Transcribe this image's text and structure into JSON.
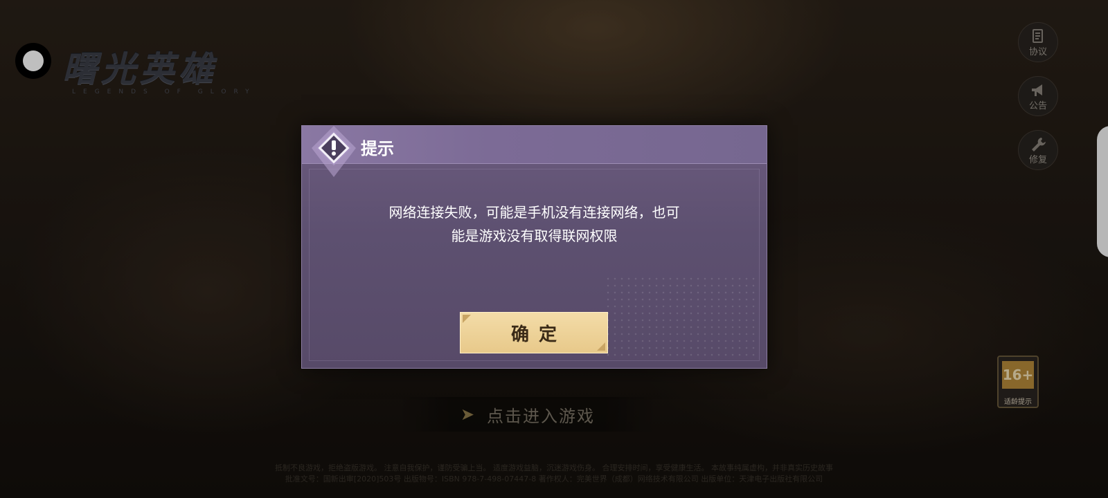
{
  "logo": {
    "title_cn": "曙光英雄",
    "title_en": "LEGENDS OF GLORY"
  },
  "side_menu": [
    {
      "label": "协议",
      "icon": "document-icon"
    },
    {
      "label": "公告",
      "icon": "megaphone-icon"
    },
    {
      "label": "修复",
      "icon": "wrench-icon"
    }
  ],
  "age_rating": {
    "age": "16+",
    "label": "适龄提示"
  },
  "enter_game": {
    "label": "点击进入游戏"
  },
  "legal": {
    "line1": "抵制不良游戏，拒绝盗版游戏。 注意自我保护，谨防受骗上当。 适度游戏益脑，沉迷游戏伤身。 合理安排时间，享受健康生活。 本故事纯属虚构，并非真实历史故事",
    "line2": "批准文号：国新出审[2020]503号 出版物号：ISBN 978-7-498-07447-8 著作权人：完美世界（成都）网络技术有限公司 出版单位：天津电子出版社有限公司"
  },
  "dialog": {
    "title": "提示",
    "message_line1": "网络连接失败，可能是手机没有连接网络，也可",
    "message_line2": "能是游戏没有取得联网权限",
    "confirm_label": "确定"
  },
  "colors": {
    "dialog_header": "#8a78a3",
    "dialog_body": "#5d5070",
    "button": "#e8c98a"
  }
}
